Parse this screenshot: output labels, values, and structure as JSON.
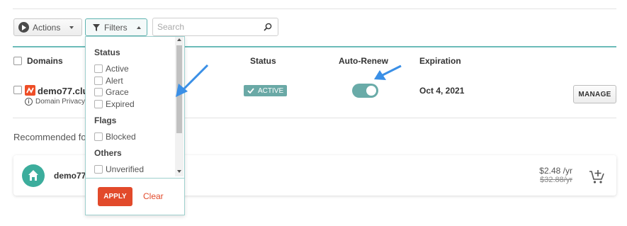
{
  "toolbar": {
    "actions_label": "Actions",
    "filters_label": "Filters",
    "search_placeholder": "Search"
  },
  "table": {
    "headers": {
      "domains": "Domains",
      "status": "Status",
      "auto_renew": "Auto-Renew",
      "expiration": "Expiration"
    },
    "rows": [
      {
        "domain": "demo77.club",
        "privacy": "Domain Privacy",
        "status": "ACTIVE",
        "auto_renew": true,
        "expiration": "Oct 4, 2021",
        "action_label": "MANAGE"
      }
    ]
  },
  "recommended": {
    "title": "Recommended fo",
    "items": [
      {
        "name": "demo77.",
        "price": "$2.48 /yr",
        "old_price": "$32.88/yr"
      }
    ]
  },
  "filters_dropdown": {
    "sections": [
      {
        "title": "Status",
        "options": [
          "Active",
          "Alert",
          "Grace",
          "Expired"
        ]
      },
      {
        "title": "Flags",
        "options": [
          "Blocked"
        ]
      },
      {
        "title": "Others",
        "options": [
          "Unverified"
        ]
      }
    ],
    "apply_label": "APPLY",
    "clear_label": "Clear"
  },
  "colors": {
    "accent_teal": "#6cbcb9",
    "status_active": "#6aa9a6",
    "apply_red": "#e24a2b",
    "annotation_arrow": "#3a8fe6",
    "brand_logo": "#ee4e27",
    "recommended_icon": "#3cad9c"
  },
  "icons": {
    "actions": "play-circle-icon",
    "filters": "funnel-icon",
    "search": "search-icon",
    "privacy": "info-icon",
    "home": "home-icon",
    "cart": "add-to-cart-icon"
  }
}
